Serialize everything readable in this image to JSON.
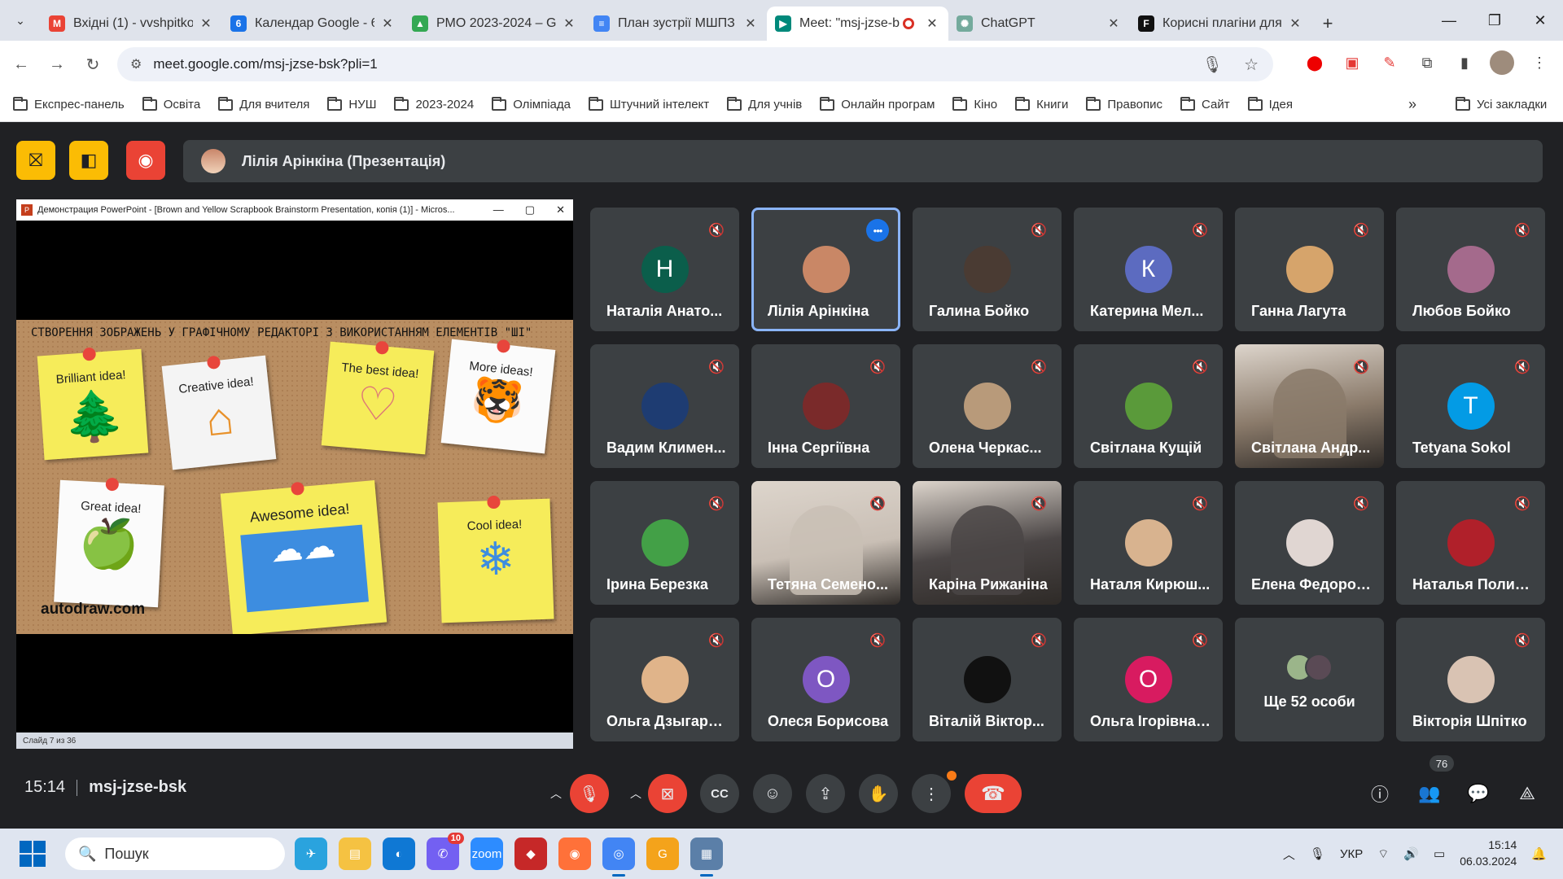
{
  "browser": {
    "tabs": [
      {
        "title": "Вхідні (1) - vvshpitko",
        "icon": "gmail-icon",
        "color": "#ea4335",
        "glyph": "M"
      },
      {
        "title": "Календар Google - 6",
        "icon": "calendar-icon",
        "color": "#1a73e8",
        "glyph": "6"
      },
      {
        "title": "РМО 2023-2024 – Gc",
        "icon": "drive-icon",
        "color": "#34a853",
        "glyph": "▲"
      },
      {
        "title": "План зустрії МШПЗ",
        "icon": "docs-icon",
        "color": "#4285f4",
        "glyph": "≡"
      },
      {
        "title": "Meet: \"msj-jzse-b",
        "icon": "meet-icon",
        "color": "#00897b",
        "glyph": "▶"
      },
      {
        "title": "ChatGPT",
        "icon": "chatgpt-icon",
        "color": "#74aa9c",
        "glyph": "✺"
      },
      {
        "title": "Корисні плагіни для",
        "icon": "f-icon",
        "color": "#111111",
        "glyph": "F"
      }
    ],
    "url": "meet.google.com/msj-jzse-bsk?pli=1",
    "bookmarks": [
      "Експрес-панель",
      "Освіта",
      "Для вчителя",
      "НУШ",
      "2023-2024",
      "Олімпіада",
      "Штучний інтелект",
      "Для учнів",
      "Онлайн програм",
      "Кіно",
      "Книги",
      "Правопис",
      "Сайт",
      "Ідея"
    ],
    "all_bookmarks": "Усі закладки"
  },
  "meet": {
    "presenter_bar": "Лілія Арінкіна (Презентація)",
    "presentation": {
      "window_title": "Демонстрация PowerPoint - [Brown and Yellow Scrapbook Brainstorm Presentation, копія (1)] - Micros...",
      "slide_title": "СТВОРЕННЯ ЗОБРАЖЕНЬ У ГРАФІЧНОМУ РЕДАКТОРІ З ВИКОРИСТАННЯМ ЕЛЕМЕНТІВ \"ШІ\"",
      "notes": [
        "Brilliant idea!",
        "Creative idea!",
        "The best idea!",
        "More ideas!",
        "Great idea!",
        "Awesome idea!",
        "Cool idea!"
      ],
      "link": "autodraw.com",
      "status": "Слайд 7 из 36"
    },
    "participants": [
      {
        "name": "Наталія Анато...",
        "initial": "Н",
        "color": "#0b5e4b"
      },
      {
        "name": "Лілія Арінкіна",
        "initial": "",
        "color": "#c98766",
        "speaking": true
      },
      {
        "name": "Галина Бойко",
        "initial": "",
        "color": "#4a3b33"
      },
      {
        "name": "Катерина Мел...",
        "initial": "К",
        "color": "#5c6bc0"
      },
      {
        "name": "Ганна Лагута",
        "initial": "",
        "color": "#d6a46b"
      },
      {
        "name": "Любов Бойко",
        "initial": "",
        "color": "#a46a8c"
      },
      {
        "name": "Вадим Климен...",
        "initial": "",
        "color": "#1e3c72"
      },
      {
        "name": "Інна Сергіївна",
        "initial": "",
        "color": "#7a2a2a"
      },
      {
        "name": "Олена Черкас...",
        "initial": "",
        "color": "#b89a7a"
      },
      {
        "name": "Світлана Кущій",
        "initial": "",
        "color": "#5a9a3a"
      },
      {
        "name": "Світлана Андр...",
        "initial": "",
        "color": "#8a7a6a",
        "video": true
      },
      {
        "name": "Tetyana Sokol",
        "initial": "T",
        "color": "#039be5"
      },
      {
        "name": "Ірина Березка",
        "initial": "",
        "color": "#43a047"
      },
      {
        "name": "Тетяна Семено...",
        "initial": "",
        "color": "#c9bfb5",
        "video": true
      },
      {
        "name": "Каріна Рижаніна",
        "initial": "",
        "color": "#4a4545",
        "video": true
      },
      {
        "name": "Наталя Кирюш...",
        "initial": "",
        "color": "#d8b38f"
      },
      {
        "name": "Елена Федорова",
        "initial": "",
        "color": "#e0d6d2"
      },
      {
        "name": "Наталья Полис...",
        "initial": "",
        "color": "#b0202a"
      },
      {
        "name": "Ольга Дзыгарс...",
        "initial": "",
        "color": "#e0b48a"
      },
      {
        "name": "Олеся Борисова",
        "initial": "О",
        "color": "#7e57c2"
      },
      {
        "name": "Віталій Віктор...",
        "initial": "",
        "color": "#111111"
      },
      {
        "name": "Ольга Ігорівна ...",
        "initial": "О",
        "color": "#d81b60"
      },
      {
        "name": "Ще 52 особи",
        "initial": "",
        "color": "#3c4043",
        "more": true
      },
      {
        "name": "Вікторія Шпітко",
        "initial": "",
        "color": "#d9c3b3"
      }
    ],
    "time": "15:14",
    "meeting_code": "msj-jzse-bsk",
    "participant_count": "76"
  },
  "taskbar": {
    "search_placeholder": "Пошук",
    "lang": "УКР",
    "time": "15:14",
    "date": "06.03.2024",
    "viber_badge": "10"
  }
}
